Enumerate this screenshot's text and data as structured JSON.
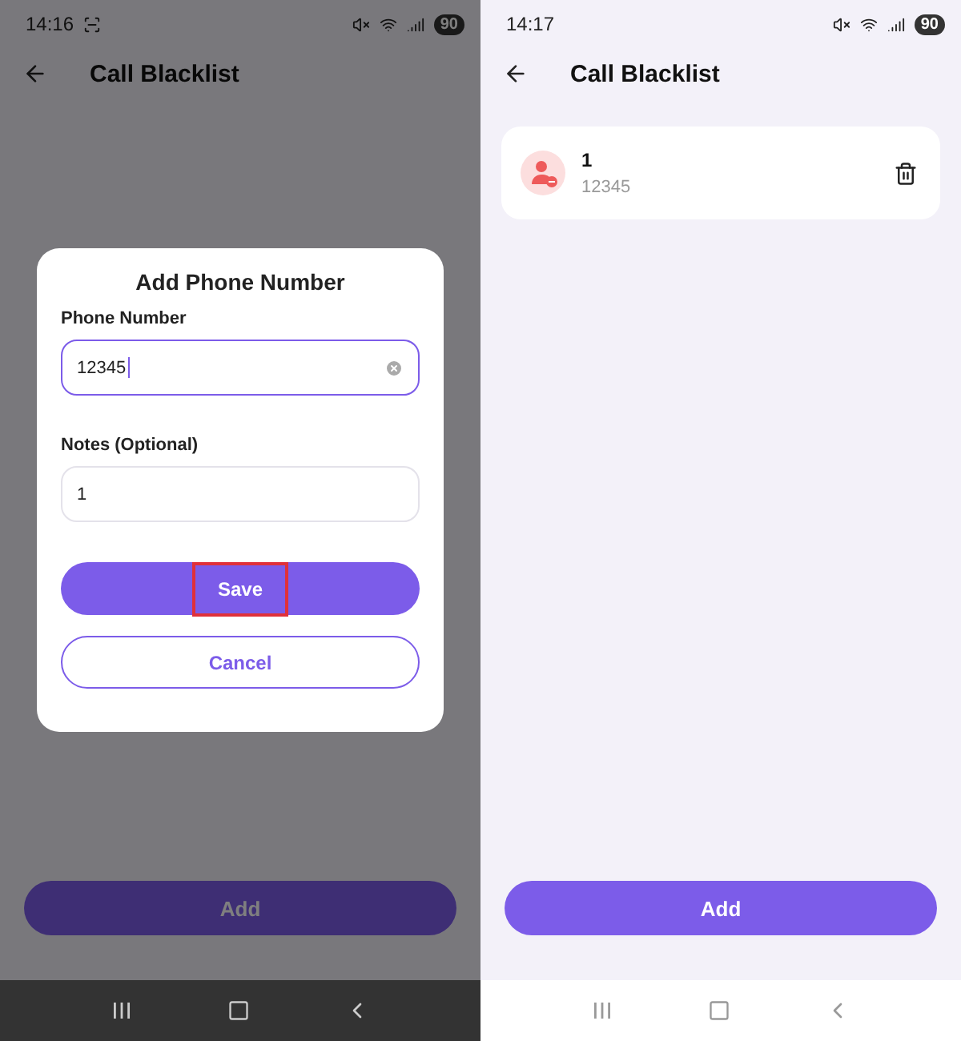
{
  "screens": [
    {
      "status_bar": {
        "time": "14:16",
        "battery": "90",
        "screenshot_indicator": true
      },
      "header": {
        "title": "Call Blacklist"
      },
      "add_button": {
        "label": "Add"
      },
      "dialog": {
        "title": "Add Phone Number",
        "fields": [
          {
            "label": "Phone Number",
            "value": "12345",
            "focused": true,
            "clearable": true
          },
          {
            "label": "Notes (Optional)",
            "value": "1",
            "focused": false,
            "clearable": false
          }
        ],
        "buttons": [
          {
            "label": "Save",
            "kind": "primary",
            "highlighted": true
          },
          {
            "label": "Cancel",
            "kind": "outline",
            "highlighted": false
          }
        ]
      },
      "nav_bar": {
        "dark": true
      }
    },
    {
      "status_bar": {
        "time": "14:17",
        "battery": "90",
        "screenshot_indicator": false
      },
      "header": {
        "title": "Call Blacklist"
      },
      "entries": [
        {
          "name": "1",
          "number": "12345"
        }
      ],
      "add_button": {
        "label": "Add"
      },
      "nav_bar": {
        "dark": false
      }
    }
  ]
}
